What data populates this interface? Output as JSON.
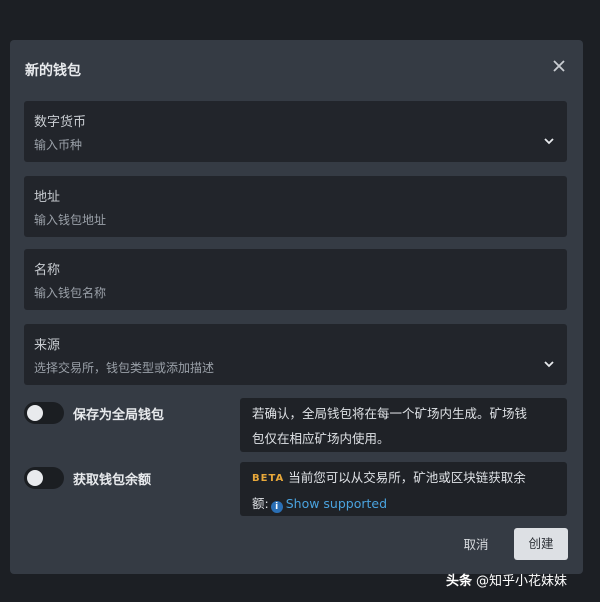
{
  "dialog": {
    "title": "新的钱包",
    "close_icon": "close-icon"
  },
  "fields": {
    "currency": {
      "label": "数字货币",
      "placeholder": "输入币种",
      "icon": "chevron-down-icon"
    },
    "address": {
      "label": "地址",
      "placeholder": "输入钱包地址"
    },
    "name": {
      "label": "名称",
      "placeholder": "输入钱包名称"
    },
    "source": {
      "label": "来源",
      "placeholder": "选择交易所，钱包类型或添加描述",
      "icon": "chevron-down-icon"
    }
  },
  "options": {
    "global": {
      "label": "保存为全局钱包",
      "enabled": false,
      "note_line1": "若确认，全局钱包将在每一个矿场内生成。矿场钱",
      "note_line2": "包仅在相应矿场内使用。"
    },
    "balance": {
      "label": "获取钱包余额",
      "enabled": false,
      "badge": "BETA",
      "note_line1": "当前您可以从交易所，矿池或区块链获取余",
      "note_line2_prefix": "额:",
      "info_icon": "info-icon",
      "link": "Show supported"
    }
  },
  "buttons": {
    "cancel": "取消",
    "create": "创建"
  },
  "watermark": {
    "brand": "头条",
    "handle": "@知乎小花妹妹"
  },
  "colors": {
    "background": "#1c1f24",
    "dialog": "#353b44",
    "field": "#22252b",
    "beta": "#e8a83a",
    "link": "#4aa3df",
    "primary_button": "#dde0e4"
  }
}
